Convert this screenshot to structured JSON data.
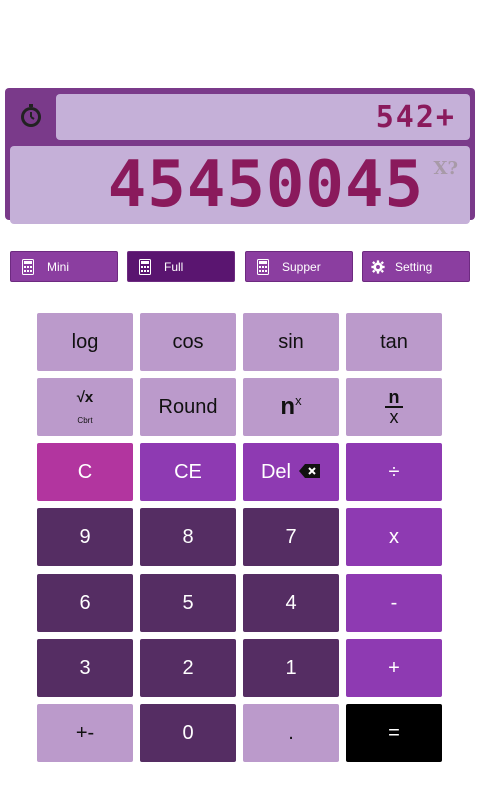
{
  "display": {
    "timer_icon": "stopwatch-icon",
    "expression": "542+",
    "result": "45450045",
    "result_hint": "X?"
  },
  "modes": [
    {
      "label": "Mini",
      "icon": "calculator-icon"
    },
    {
      "label": "Full",
      "icon": "calculator-icon",
      "active": true
    },
    {
      "label": "Supper",
      "icon": "calculator-icon"
    },
    {
      "label": "Setting",
      "icon": "gear-icon"
    }
  ],
  "keys": {
    "log": "log",
    "cos": "cos",
    "sin": "sin",
    "tan": "tan",
    "cbrt_symbol": "√x",
    "cbrt_label": "Cbrt",
    "round": "Round",
    "power_base": "n",
    "power_exp": "x",
    "frac_num": "n",
    "frac_den": "x",
    "clear": "C",
    "clear_entry": "CE",
    "delete": "Del",
    "divide": "÷",
    "n9": "9",
    "n8": "8",
    "n7": "7",
    "multiply": "x",
    "n6": "6",
    "n5": "5",
    "n4": "4",
    "minus": "-",
    "n3": "3",
    "n2": "2",
    "n1": "1",
    "plus": "+",
    "negate": "+-",
    "n0": "0",
    "dot": ".",
    "equals": "="
  },
  "colors": {
    "panel": "#7a3a8a",
    "screen": "#c5b0d8",
    "digits": "#8a1a5c",
    "key_light": "#bb9acb",
    "key_dark": "#552d63",
    "key_purple": "#8e3ab2",
    "key_magenta": "#b2359f",
    "key_equals": "#000000"
  }
}
